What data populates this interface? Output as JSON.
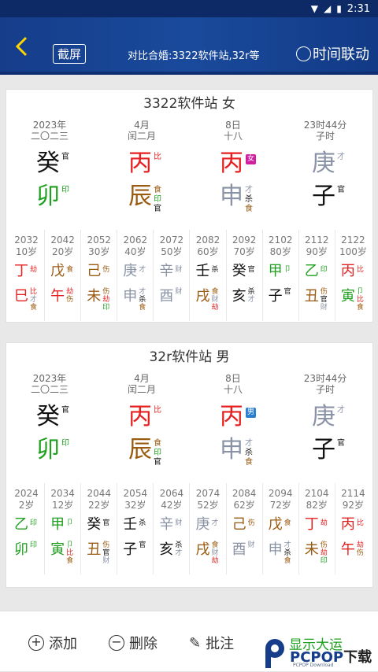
{
  "status": {
    "time": "2:31"
  },
  "header": {
    "shot_label": "截屏",
    "title": "对比合婚:3322软件站,32r等",
    "time_link": "时间联动"
  },
  "colors": {
    "red": "#e52020",
    "green": "#20a020",
    "brown": "#9a5a10",
    "gray": "#8a93a6",
    "black": "#111111",
    "header": "#153d8a"
  },
  "cards": [
    {
      "title": "3322软件站 女",
      "pillars": [
        {
          "d1": "2023年",
          "d2": "二〇二三",
          "stem": "癸",
          "stem_color": "black",
          "stem_sup": [
            "官"
          ],
          "branch": "卯",
          "branch_color": "green",
          "branch_sup": [
            "印"
          ]
        },
        {
          "d1": "4月",
          "d2": "闰二月",
          "stem": "丙",
          "stem_color": "red",
          "stem_sup": [
            "比"
          ],
          "branch": "辰",
          "branch_color": "brown",
          "branch_sup": [
            "食",
            "印",
            "官"
          ]
        },
        {
          "d1": "8日",
          "d2": "十八",
          "stem": "丙",
          "stem_color": "red",
          "stem_sup": [],
          "badge": "女",
          "badge_color": "#d020a0",
          "branch": "申",
          "branch_color": "gray",
          "branch_sup": [
            "才",
            "杀",
            "食"
          ]
        },
        {
          "d1": "23时44分",
          "d2": "子时",
          "stem": "庚",
          "stem_color": "gray",
          "stem_sup": [
            "才"
          ],
          "branch": "子",
          "branch_color": "black",
          "branch_sup": [
            "官"
          ]
        }
      ],
      "luck": [
        {
          "year": "2032",
          "age": "10岁",
          "s": "丁",
          "sc": "red",
          "ss": [
            "劫"
          ],
          "b": "巳",
          "bc": "red",
          "bs": [
            "比",
            "才",
            "食"
          ]
        },
        {
          "year": "2042",
          "age": "20岁",
          "s": "戊",
          "sc": "brown",
          "ss": [
            "食"
          ],
          "b": "午",
          "bc": "red",
          "bs": [
            "劫",
            "伤"
          ]
        },
        {
          "year": "2052",
          "age": "30岁",
          "s": "己",
          "sc": "brown",
          "ss": [
            "伤"
          ],
          "b": "未",
          "bc": "brown",
          "bs": [
            "伤",
            "劫",
            "印"
          ]
        },
        {
          "year": "2062",
          "age": "40岁",
          "s": "庚",
          "sc": "gray",
          "ss": [
            "才"
          ],
          "b": "申",
          "bc": "gray",
          "bs": [
            "才",
            "杀",
            "食"
          ]
        },
        {
          "year": "2072",
          "age": "50岁",
          "s": "辛",
          "sc": "gray",
          "ss": [
            "财"
          ],
          "b": "酉",
          "bc": "gray",
          "bs": [
            "财"
          ]
        },
        {
          "year": "2082",
          "age": "60岁",
          "s": "壬",
          "sc": "black",
          "ss": [
            "杀"
          ],
          "b": "戌",
          "bc": "brown",
          "bs": [
            "食",
            "财",
            "劫"
          ]
        },
        {
          "year": "2092",
          "age": "70岁",
          "s": "癸",
          "sc": "black",
          "ss": [
            "官"
          ],
          "b": "亥",
          "bc": "black",
          "bs": [
            "杀",
            "才"
          ]
        },
        {
          "year": "2102",
          "age": "80岁",
          "s": "甲",
          "sc": "green",
          "ss": [
            "卩"
          ],
          "b": "子",
          "bc": "black",
          "bs": [
            "官"
          ]
        },
        {
          "year": "2112",
          "age": "90岁",
          "s": "乙",
          "sc": "green",
          "ss": [
            "印"
          ],
          "b": "丑",
          "bc": "brown",
          "bs": [
            "伤",
            "官",
            "财"
          ]
        },
        {
          "year": "2122",
          "age": "100岁",
          "s": "丙",
          "sc": "red",
          "ss": [
            "比"
          ],
          "b": "寅",
          "bc": "green",
          "bs": [
            "卩",
            "比",
            "食"
          ]
        }
      ]
    },
    {
      "title": "32r软件站 男",
      "pillars": [
        {
          "d1": "2023年",
          "d2": "二〇二三",
          "stem": "癸",
          "stem_color": "black",
          "stem_sup": [
            "官"
          ],
          "branch": "卯",
          "branch_color": "green",
          "branch_sup": [
            "印"
          ]
        },
        {
          "d1": "4月",
          "d2": "闰二月",
          "stem": "丙",
          "stem_color": "red",
          "stem_sup": [
            "比"
          ],
          "branch": "辰",
          "branch_color": "brown",
          "branch_sup": [
            "食",
            "印",
            "官"
          ]
        },
        {
          "d1": "8日",
          "d2": "十八",
          "stem": "丙",
          "stem_color": "red",
          "stem_sup": [],
          "badge": "男",
          "badge_color": "#2a7fd0",
          "branch": "申",
          "branch_color": "gray",
          "branch_sup": [
            "才",
            "杀",
            "食"
          ]
        },
        {
          "d1": "23时44分",
          "d2": "子时",
          "stem": "庚",
          "stem_color": "gray",
          "stem_sup": [
            "才"
          ],
          "branch": "子",
          "branch_color": "black",
          "branch_sup": [
            "官"
          ]
        }
      ],
      "luck": [
        {
          "year": "2024",
          "age": "2岁",
          "s": "乙",
          "sc": "green",
          "ss": [
            "印"
          ],
          "b": "卯",
          "bc": "green",
          "bs": [
            "印"
          ]
        },
        {
          "year": "2034",
          "age": "12岁",
          "s": "甲",
          "sc": "green",
          "ss": [
            "卩"
          ],
          "b": "寅",
          "bc": "green",
          "bs": [
            "卩",
            "比",
            "食"
          ]
        },
        {
          "year": "2044",
          "age": "22岁",
          "s": "癸",
          "sc": "black",
          "ss": [
            "官"
          ],
          "b": "丑",
          "bc": "brown",
          "bs": [
            "伤",
            "官",
            "财"
          ]
        },
        {
          "year": "2054",
          "age": "32岁",
          "s": "壬",
          "sc": "black",
          "ss": [
            "杀"
          ],
          "b": "子",
          "bc": "black",
          "bs": [
            "官"
          ]
        },
        {
          "year": "2064",
          "age": "42岁",
          "s": "辛",
          "sc": "gray",
          "ss": [
            "财"
          ],
          "b": "亥",
          "bc": "black",
          "bs": [
            "杀",
            "才"
          ]
        },
        {
          "year": "2074",
          "age": "52岁",
          "s": "庚",
          "sc": "gray",
          "ss": [
            "才"
          ],
          "b": "戌",
          "bc": "brown",
          "bs": [
            "食",
            "财",
            "劫"
          ]
        },
        {
          "year": "2084",
          "age": "62岁",
          "s": "己",
          "sc": "brown",
          "ss": [
            "伤"
          ],
          "b": "酉",
          "bc": "gray",
          "bs": [
            "财"
          ]
        },
        {
          "year": "2094",
          "age": "72岁",
          "s": "戊",
          "sc": "brown",
          "ss": [
            "食"
          ],
          "b": "申",
          "bc": "gray",
          "bs": [
            "才",
            "杀",
            "食"
          ]
        },
        {
          "year": "2104",
          "age": "82岁",
          "s": "丁",
          "sc": "red",
          "ss": [
            "劫"
          ],
          "b": "未",
          "bc": "brown",
          "bs": [
            "伤",
            "劫",
            "印"
          ]
        },
        {
          "year": "2114",
          "age": "92岁",
          "s": "丙",
          "sc": "red",
          "ss": [
            "比"
          ],
          "b": "午",
          "bc": "red",
          "bs": [
            "劫",
            "伤"
          ]
        }
      ]
    }
  ],
  "bottom": {
    "add": "添加",
    "delete": "删除",
    "note": "批注",
    "show_yun": "显示大运"
  },
  "watermark": {
    "brand": "PCPOP",
    "suffix": "下载",
    "sub": "PCPOP Download"
  }
}
